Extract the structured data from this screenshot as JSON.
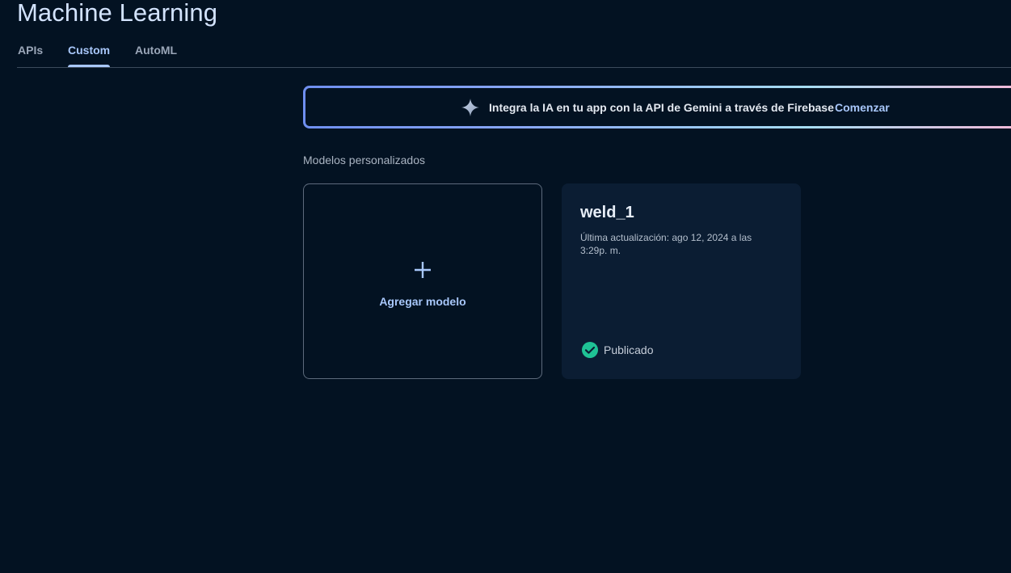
{
  "page": {
    "title": "Machine Learning"
  },
  "tabs": [
    {
      "label": "APIs",
      "active": false
    },
    {
      "label": "Custom",
      "active": true
    },
    {
      "label": "AutoML",
      "active": false
    }
  ],
  "banner": {
    "icon": "sparkle-icon",
    "text": "Integra la IA en tu app con la API de Gemini a través de Firebase",
    "link_label": "Comenzar"
  },
  "section": {
    "label": "Modelos personalizados"
  },
  "add_model": {
    "icon": "plus-icon",
    "label": "Agregar modelo"
  },
  "models": [
    {
      "name": "weld_1",
      "updated": "Última actualización: ago 12, 2024 a las 3:29p. m.",
      "status": "Publicado",
      "status_icon": "check-circle-icon",
      "status_color": "#1fc295"
    }
  ],
  "colors": {
    "background": "#031222",
    "accent": "#a8c7fa",
    "card": "#0b1d33"
  }
}
